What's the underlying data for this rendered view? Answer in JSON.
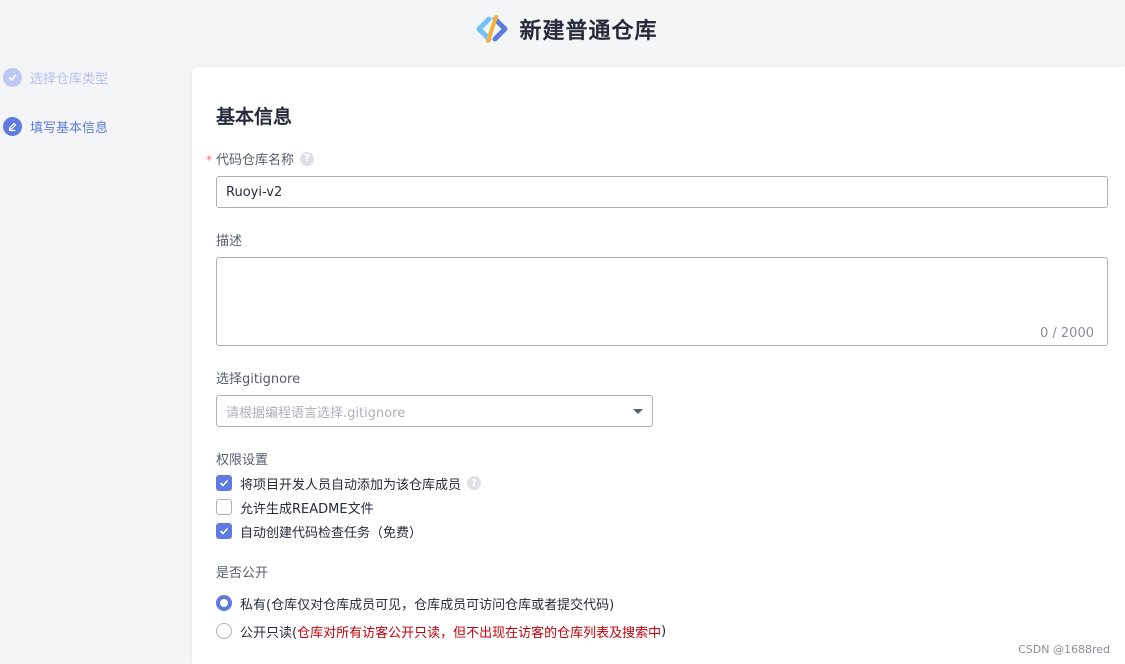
{
  "header": {
    "title": "新建普通仓库",
    "logo_icon": "devcloud-logo-icon"
  },
  "steps": [
    {
      "label": "选择仓库类型",
      "status": "done"
    },
    {
      "label": "填写基本信息",
      "status": "active"
    }
  ],
  "form": {
    "section_title": "基本信息",
    "repo_name": {
      "label": "代码仓库名称",
      "required_mark": "*",
      "value": "Ruoyi-v2"
    },
    "description": {
      "label": "描述",
      "counter": "0 / 2000"
    },
    "gitignore": {
      "label": "选择gitignore",
      "placeholder": "请根据编程语言选择.gitignore"
    },
    "permissions": {
      "label": "权限设置",
      "options": [
        {
          "label": "将项目开发人员自动添加为该仓库成员",
          "checked": true,
          "help": true
        },
        {
          "label": "允许生成README文件",
          "checked": false
        },
        {
          "label": "自动创建代码检查任务（免费）",
          "checked": true
        }
      ]
    },
    "visibility": {
      "label": "是否公开",
      "private_label": "私有(仓库仅对仓库成员可见，仓库成员可访问仓库或者提交代码)",
      "public_label_prefix": "公开只读(",
      "public_label_warning": "仓库对所有访客公开只读，但不出现在访客的仓库列表及搜索中",
      "public_label_suffix": " )",
      "selected": "private"
    }
  },
  "watermark": "CSDN @1688red",
  "colors": {
    "accent": "#5e7ce0",
    "warning": "#c7000b",
    "required": "#f66f6a"
  }
}
